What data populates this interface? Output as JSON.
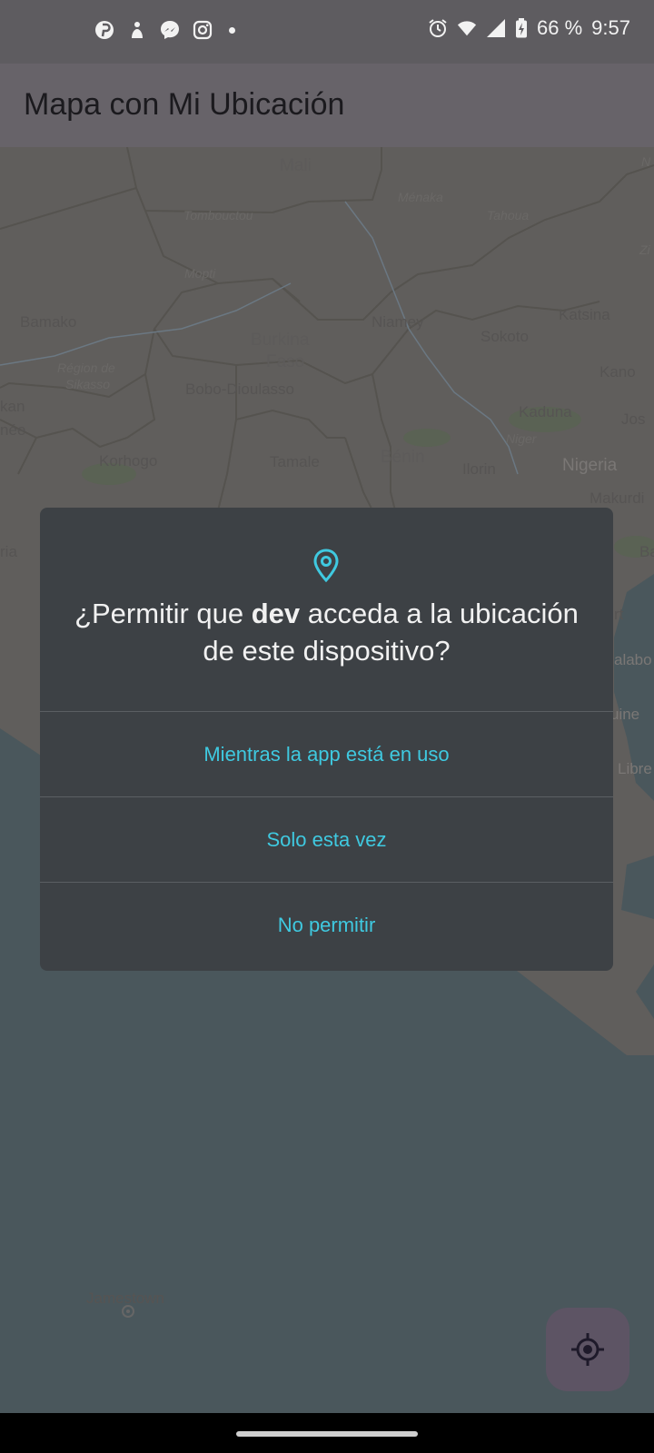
{
  "status_bar": {
    "battery": "66 %",
    "time": "9:57",
    "left_icons": [
      "pinterest-icon",
      "pet-app-icon",
      "messenger-icon",
      "instagram-icon",
      "more-notifications-dot"
    ],
    "right_icons": [
      "alarm-icon",
      "wifi-icon",
      "signal-icon",
      "battery-charging-icon"
    ]
  },
  "app_bar": {
    "title": "Mapa con Mi Ubicación"
  },
  "map": {
    "labels": {
      "mali": "Mali",
      "menaka": "Ménaka",
      "tombouctou": "Tombouctou",
      "tahoua": "Tahoua",
      "mopti": "Mopti",
      "niamey": "Niamey",
      "katsina": "Katsina",
      "bamako": "Bamako",
      "sokoto": "Sokoto",
      "burkina": "Burkina",
      "faso": "Faso",
      "region_de": "Région de",
      "sikasso": "Sikasso",
      "kano": "Kano",
      "bobo": "Bobo-Dioulasso",
      "kaduna": "Kaduna",
      "kan": "kan",
      "nee": "née",
      "jos": "Jos",
      "niger": "Niger",
      "korhogo": "Korhogo",
      "tamale": "Tamale",
      "benin": "Bénin",
      "ilorin": "Ilorin",
      "nigeria": "Nigeria",
      "makurdi": "Makurdi",
      "ria": "ria",
      "ba": "Ba",
      "rt": "rt",
      "alabo": "alabo",
      "uine": "uine",
      "libre": "Libre",
      "n_edge": "N",
      "zi_edge": "Zi",
      "jamestown": "Jamestown"
    }
  },
  "dialog": {
    "icon": "location-pin-icon",
    "title_prefix": "¿Permitir que ",
    "app_name": "dev",
    "title_suffix": " acceda a la ubicación de este dispositivo?",
    "options": [
      "Mientras la app está en uso",
      "Solo esta vez",
      "No permitir"
    ]
  },
  "fab": {
    "icon": "my-location-icon"
  },
  "colors": {
    "status_bar": "#5e5c60",
    "app_bar": "#676369",
    "dialog_bg": "#3d4145",
    "accent": "#3fc9e0",
    "fab_bg": "#5d5464",
    "sea": "#4a575c",
    "land": "#5f5e5c"
  }
}
